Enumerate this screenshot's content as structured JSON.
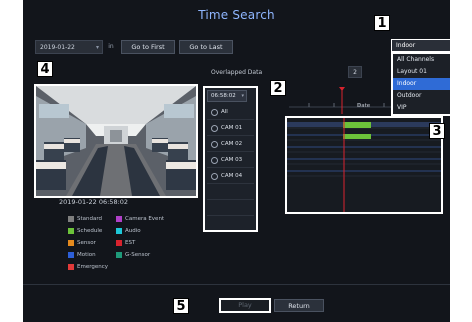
{
  "window": {
    "title": "Time Search"
  },
  "toolbar": {
    "date": "2019-01-22",
    "in_label": "in",
    "go_first_label": "Go to First",
    "go_last_label": "Go to Last"
  },
  "overlapped": {
    "label": "Overlapped Data",
    "value": "2"
  },
  "view_mode": {
    "selected": "Indoor",
    "options": [
      "All Channels",
      "Layout 01",
      "Indoor",
      "Outdoor",
      "VIP"
    ]
  },
  "preview": {
    "timestamp": "2019-01-22 06:58:02"
  },
  "channels": {
    "time": "06:58:02",
    "items": [
      "All",
      "CAM 01",
      "CAM 02",
      "CAM 03",
      "CAM 04"
    ]
  },
  "timeline": {
    "date_label": "Date"
  },
  "legend": [
    {
      "label": "Standard",
      "color": "#7f7f7f"
    },
    {
      "label": "Camera Event",
      "color": "#b040c8"
    },
    {
      "label": "Schedule",
      "color": "#6cc23a"
    },
    {
      "label": "Audio",
      "color": "#1ec8d8"
    },
    {
      "label": "Sensor",
      "color": "#e58a1e"
    },
    {
      "label": "EST",
      "color": "#d8232e"
    },
    {
      "label": "Motion",
      "color": "#2d5fd8"
    },
    {
      "label": "G-Sensor",
      "color": "#1f9a7a"
    },
    {
      "label": "Emergency",
      "color": "#e23a3a"
    }
  ],
  "footer": {
    "play_label": "Play",
    "return_label": "Return"
  },
  "callouts": [
    "1",
    "2",
    "3",
    "4",
    "5"
  ],
  "colors": {
    "accent": "#8fb6ff",
    "selected": "#2f6bd6",
    "schedule": "#6cc23a",
    "cursor": "#d8232e"
  }
}
